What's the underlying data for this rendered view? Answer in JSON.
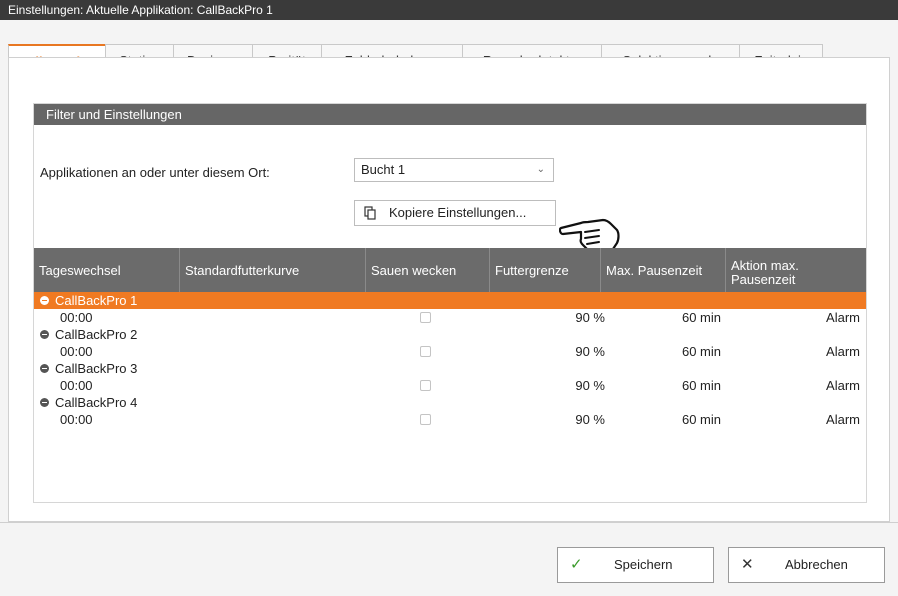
{
  "window": {
    "title": "Einstellungen: Aktuelle Applikation: CallBackPro 1"
  },
  "tabs": [
    {
      "label": "Allgemein",
      "active": true
    },
    {
      "label": "Station"
    },
    {
      "label": "Dosieren"
    },
    {
      "label": "Parität"
    },
    {
      "label": "Fehlerbehebung"
    },
    {
      "label": "Rauschedetektor"
    },
    {
      "label": "Selektionsregeln"
    },
    {
      "label": "Zeitrelais"
    }
  ],
  "panel": {
    "title": "Filter und Einstellungen",
    "location_label": "Applikationen an oder unter diesem Ort:",
    "location_value": "Bucht 1",
    "copy_button": "Kopiere Einstellungen..."
  },
  "table": {
    "headers": [
      "Tageswechsel",
      "Standardfutterkurve",
      "Sauen wecken",
      "Futtergrenze",
      "Max. Pausenzeit",
      "Aktion max. Pausenzeit"
    ],
    "groups": [
      {
        "name": "CallBackPro 1",
        "selected": true,
        "row": {
          "time": "00:00",
          "curve": "",
          "wake": false,
          "limit": "90 %",
          "pause": "60 min",
          "action": "Alarm"
        }
      },
      {
        "name": "CallBackPro 2",
        "selected": false,
        "row": {
          "time": "00:00",
          "curve": "",
          "wake": false,
          "limit": "90 %",
          "pause": "60 min",
          "action": "Alarm"
        }
      },
      {
        "name": "CallBackPro 3",
        "selected": false,
        "row": {
          "time": "00:00",
          "curve": "",
          "wake": false,
          "limit": "90 %",
          "pause": "60 min",
          "action": "Alarm"
        }
      },
      {
        "name": "CallBackPro 4",
        "selected": false,
        "row": {
          "time": "00:00",
          "curve": "",
          "wake": false,
          "limit": "90 %",
          "pause": "60 min",
          "action": "Alarm"
        }
      }
    ]
  },
  "footer": {
    "save_label": "Speichern",
    "cancel_label": "Abbrechen"
  },
  "colors": {
    "accent": "#e87722",
    "header_bg": "#666666",
    "selected_row": "#f07a22",
    "save_check": "#3a9a2a"
  }
}
